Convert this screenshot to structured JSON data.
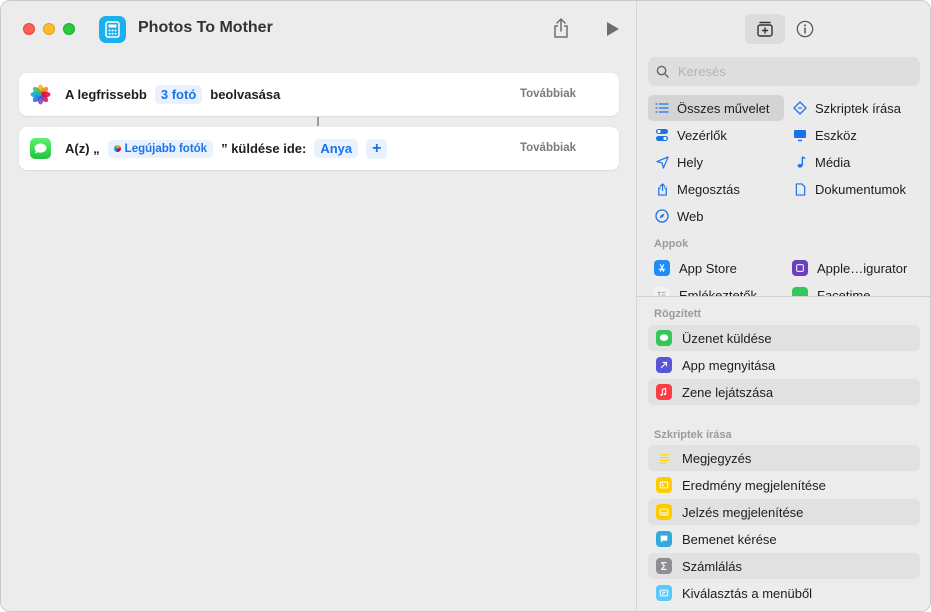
{
  "window": {
    "title": "Photos To Mother"
  },
  "actions": [
    {
      "prefix": "A legfrissebb",
      "token": "3 fotó",
      "suffix": "beolvasása",
      "more": "Továbbiak"
    },
    {
      "prefix": "A(z) „",
      "token": "Legújabb fotók",
      "middle": "” küldése ide:",
      "recipient": "Anya",
      "add": "+",
      "more": "Továbbiak"
    }
  ],
  "library": {
    "search_placeholder": "Keresés",
    "categories": [
      {
        "label": "Összes művelet",
        "icon": "list-icon",
        "selected": true
      },
      {
        "label": "Szkriptek írása",
        "icon": "scripting-icon"
      },
      {
        "label": "Vezérlők",
        "icon": "toggle-icon"
      },
      {
        "label": "Eszköz",
        "icon": "display-icon"
      },
      {
        "label": "Hely",
        "icon": "location-icon"
      },
      {
        "label": "Média",
        "icon": "music-note-icon"
      },
      {
        "label": "Megosztás",
        "icon": "share-icon"
      },
      {
        "label": "Dokumentumok",
        "icon": "document-icon"
      },
      {
        "label": "Web",
        "icon": "compass-icon"
      }
    ],
    "apps_label": "Appok",
    "apps": [
      {
        "label": "App Store",
        "color": "#1f8cf7"
      },
      {
        "label": "Apple…igurator",
        "color": "#6a3fbf"
      },
      {
        "label": "Emlékeztetők",
        "color": "#f2f2f2"
      },
      {
        "label": "Facetime",
        "color": "#34c759"
      }
    ],
    "pinned_label": "Rögzített",
    "pinned": [
      {
        "label": "Üzenet küldése",
        "color": "#34c759",
        "icon": "message-icon"
      },
      {
        "label": "App megnyitása",
        "color": "#5856d6",
        "icon": "open-app-icon"
      },
      {
        "label": "Zene lejátszása",
        "color": "#fc3c44",
        "icon": "music-icon"
      }
    ],
    "scripting_label": "Szkriptek írása",
    "scripting": [
      {
        "label": "Megjegyzés",
        "color": "#ffd60a",
        "icon": "comment-icon"
      },
      {
        "label": "Eredmény megjelenítése",
        "color": "#ffcc00",
        "icon": "show-result-icon"
      },
      {
        "label": "Jelzés megjelenítése",
        "color": "#ffcc00",
        "icon": "alert-icon"
      },
      {
        "label": "Bemenet kérése",
        "color": "#34aadc",
        "icon": "ask-input-icon"
      },
      {
        "label": "Számlálás",
        "color": "#8e8e93",
        "icon": "sigma-icon"
      },
      {
        "label": "Kiválasztás a menüből",
        "color": "#5ac8fa",
        "icon": "menu-icon"
      }
    ]
  }
}
